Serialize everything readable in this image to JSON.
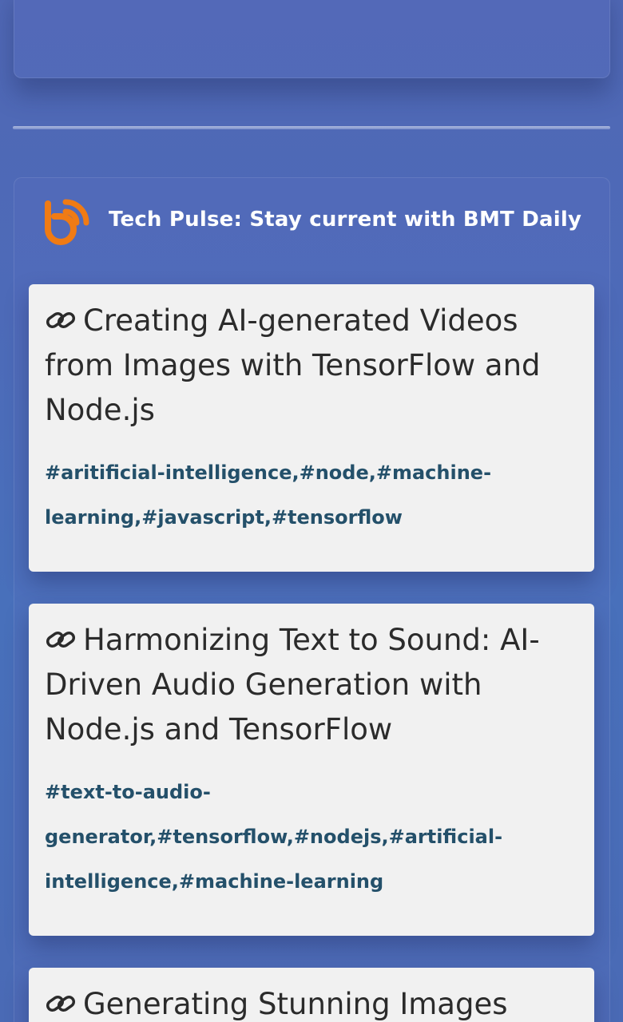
{
  "feed": {
    "title": "Tech Pulse: Stay current with BMT Daily",
    "logo_icon": "bmt-rss-logo-icon",
    "accent_color": "#f07b14"
  },
  "articles": [
    {
      "title": "Creating AI-generated Videos from Images with TensorFlow and Node.js",
      "tags": "#aritificial-intelligence,#node,#machine-learning,#javascript,#tensorflow"
    },
    {
      "title": "Harmonizing Text to Sound: AI-Driven Audio Generation with Node.js and TensorFlow",
      "tags": "#text-to-audio-generator,#tensorflow,#nodejs,#artificial-intelligence,#machine-learning"
    },
    {
      "title": "Generating Stunning Images",
      "tags": ""
    }
  ],
  "colors": {
    "card_bg": "#f1f1f1",
    "title_text": "#2b2b2b",
    "tag_text": "#24506a"
  }
}
